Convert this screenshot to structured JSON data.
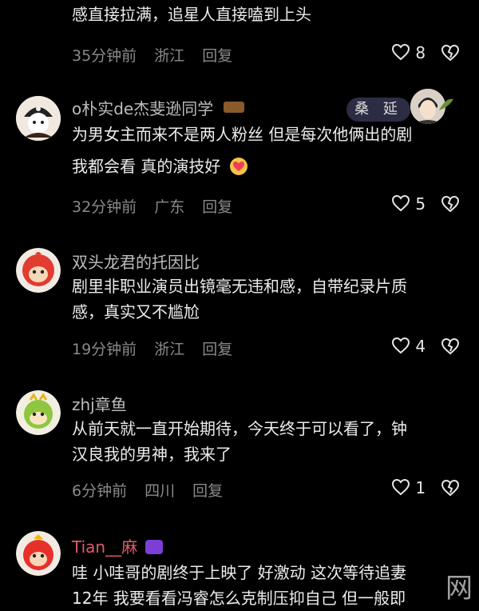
{
  "comments": [
    {
      "text_lines": [
        "感直接拉满，追星人直接嗑到上头"
      ],
      "time": "35分钟前",
      "location": "浙江",
      "reply": "回复",
      "likes": "8"
    },
    {
      "username": "o朴实de杰斐逊同学",
      "badge": "桑 延",
      "text_lines": [
        "为男女主而来不是两人粉丝 但是每次他俩出的剧",
        "我都会看 真的演技好"
      ],
      "time": "32分钟前",
      "location": "广东",
      "reply": "回复",
      "likes": "5"
    },
    {
      "username": "双头龙君的托因比",
      "text_lines": [
        "剧里非职业演员出镜毫无违和感，自带纪录片质",
        "感，真实又不尴尬"
      ],
      "time": "19分钟前",
      "location": "浙江",
      "reply": "回复",
      "likes": "4"
    },
    {
      "username": "zhj章鱼",
      "text_lines": [
        "从前天就一直开始期待，今天终于可以看了，钟",
        "汉良我的男神，我来了"
      ],
      "time": "6分钟前",
      "location": "四川",
      "reply": "回复",
      "likes": "1"
    },
    {
      "username": "Tian__麻",
      "text_lines": [
        "哇 小哇哥的剧终于上映了 好激动 这次等待追妻",
        "12年 我要看看冯睿怎么克制压抑自己 但一般即"
      ]
    }
  ],
  "watermark": "网"
}
